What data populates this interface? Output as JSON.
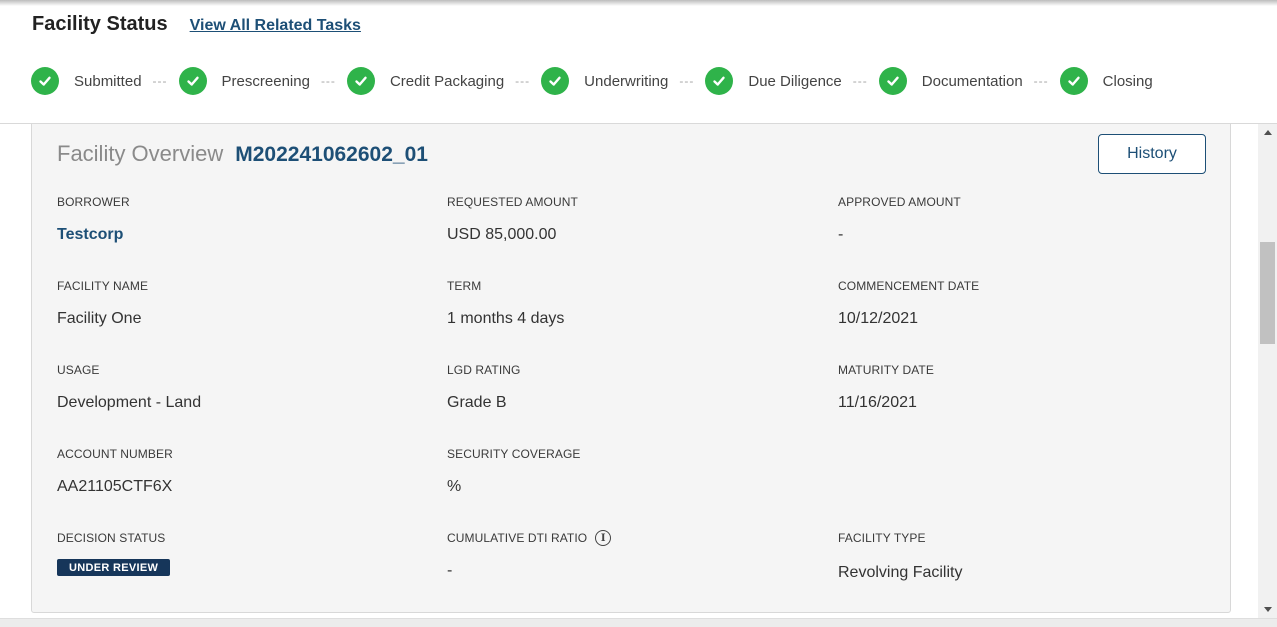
{
  "header": {
    "title": "Facility Status",
    "related_link": "View All Related Tasks"
  },
  "steps": [
    {
      "label": "Submitted",
      "status": "complete"
    },
    {
      "label": "Prescreening",
      "status": "complete"
    },
    {
      "label": "Credit Packaging",
      "status": "complete"
    },
    {
      "label": "Underwriting",
      "status": "complete"
    },
    {
      "label": "Due Diligence",
      "status": "complete"
    },
    {
      "label": "Documentation",
      "status": "complete"
    },
    {
      "label": "Closing",
      "status": "complete"
    }
  ],
  "step_connector": "---",
  "overview": {
    "label": "Facility Overview",
    "facility_id": "M202241062602_01",
    "history_button": "History",
    "fields": {
      "borrower": {
        "label": "BORROWER",
        "value": "Testcorp"
      },
      "requested_amount": {
        "label": "REQUESTED AMOUNT",
        "value": "USD 85,000.00"
      },
      "approved_amount": {
        "label": "APPROVED AMOUNT",
        "value": "-"
      },
      "facility_name": {
        "label": "FACILITY NAME",
        "value": "Facility One"
      },
      "term": {
        "label": "TERM",
        "value": "1 months 4 days"
      },
      "commencement_date": {
        "label": "COMMENCEMENT DATE",
        "value": "10/12/2021"
      },
      "usage": {
        "label": "USAGE",
        "value": "Development - Land"
      },
      "lgd_rating": {
        "label": "LGD RATING",
        "value": "Grade B"
      },
      "maturity_date": {
        "label": "MATURITY DATE",
        "value": "11/16/2021"
      },
      "account_number": {
        "label": "ACCOUNT NUMBER",
        "value": "AA21105CTF6X"
      },
      "security_coverage": {
        "label": "SECURITY COVERAGE",
        "value": "%"
      },
      "decision_status": {
        "label": "DECISION STATUS",
        "value": "UNDER REVIEW"
      },
      "cumulative_dti_ratio": {
        "label": "CUMULATIVE DTI RATIO",
        "value": "-",
        "info_glyph": "i"
      },
      "facility_type": {
        "label": "FACILITY TYPE",
        "value": "Revolving Facility"
      }
    }
  },
  "colors": {
    "accent": "#1d4f76",
    "success": "#2fb34a",
    "badge": "#16365a",
    "card_bg": "#f5f5f5"
  },
  "icons": {
    "step_complete": "check-circle-icon",
    "info": "info-circle-icon",
    "scroll_up": "triangle-up-icon",
    "scroll_down": "triangle-down-icon"
  }
}
